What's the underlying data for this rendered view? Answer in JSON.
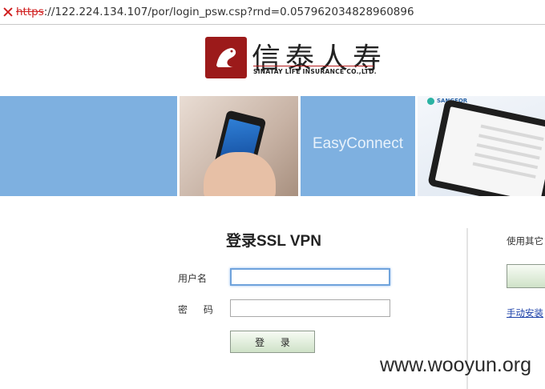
{
  "browser": {
    "url_scheme": "https",
    "url_rest": "://122.224.134.107/por/login_psw.csp?rnd=0.057962034828960896"
  },
  "logo": {
    "name_cn": "信泰人寿",
    "name_en": "SINATAY LIFE INSURANCE CO.,LTD."
  },
  "banner": {
    "product_name": "EasyConnect",
    "vendor": "SANGFOR"
  },
  "login": {
    "title": "登录SSL VPN",
    "username_label": "用户名",
    "username_value": "",
    "password_label": "密 码",
    "password_value": "",
    "submit_label": "登 录"
  },
  "other_methods": {
    "heading": "使用其它",
    "manual_install_link": "手动安装"
  },
  "watermark": "www.wooyun.org",
  "colors": {
    "banner_blue": "#7eb0e0",
    "error_red": "#d02020",
    "link_blue": "#1a3fa8"
  }
}
